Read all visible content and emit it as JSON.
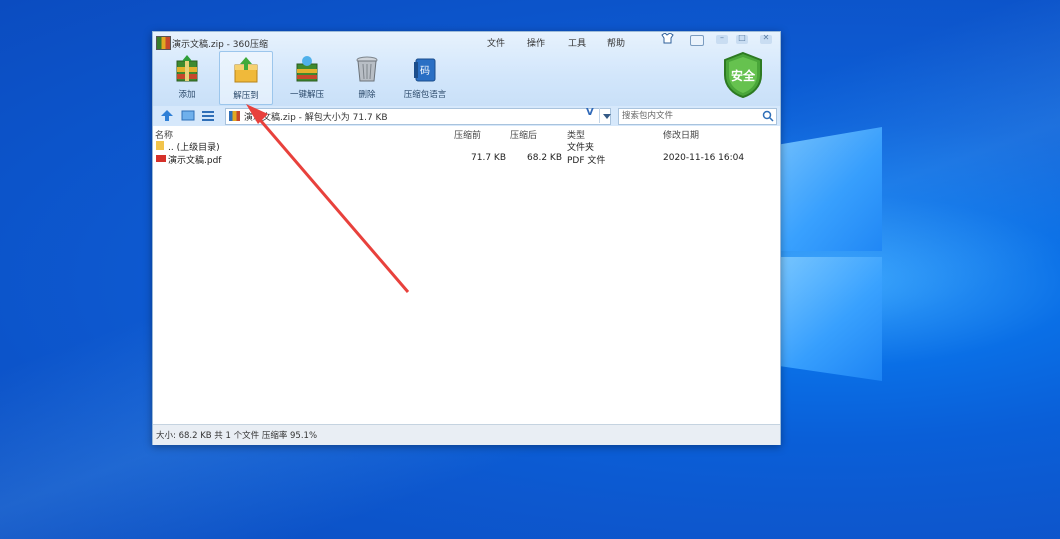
{
  "window": {
    "title": "演示文稿.zip - 360压缩",
    "menu": [
      "文件",
      "操作",
      "工具",
      "帮助"
    ]
  },
  "toolbar": [
    {
      "label": "添加",
      "icon": "add-archive-icon"
    },
    {
      "label": "解压到",
      "icon": "extract-to-icon",
      "active": true
    },
    {
      "label": "一键解压",
      "icon": "one-click-extract-icon"
    },
    {
      "label": "删除",
      "icon": "trash-icon"
    },
    {
      "label": "压缩包语言",
      "icon": "code-language-icon"
    }
  ],
  "security_badge": "安全",
  "address": {
    "path": "演示文稿.zip - 解包大小为 71.7 KB",
    "v_label": "V",
    "search_placeholder": "搜索包内文件"
  },
  "columns": [
    "名称",
    "压缩前",
    "压缩后",
    "类型",
    "修改日期"
  ],
  "files": [
    {
      "name": ".. (上级目录)",
      "before": "",
      "after": "",
      "type": "文件夹",
      "date": "",
      "icon": "folder-icon"
    },
    {
      "name": "演示文稿.pdf",
      "before": "71.7 KB",
      "after": "68.2 KB",
      "type": "PDF 文件",
      "date": "2020-11-16 16:04",
      "icon": "pdf-icon"
    }
  ],
  "status": "大小: 68.2 KB 共 1 个文件 压缩率 95.1%",
  "colors": {
    "accent_arrow": "#e8413c",
    "shield": "#4aa63a"
  }
}
